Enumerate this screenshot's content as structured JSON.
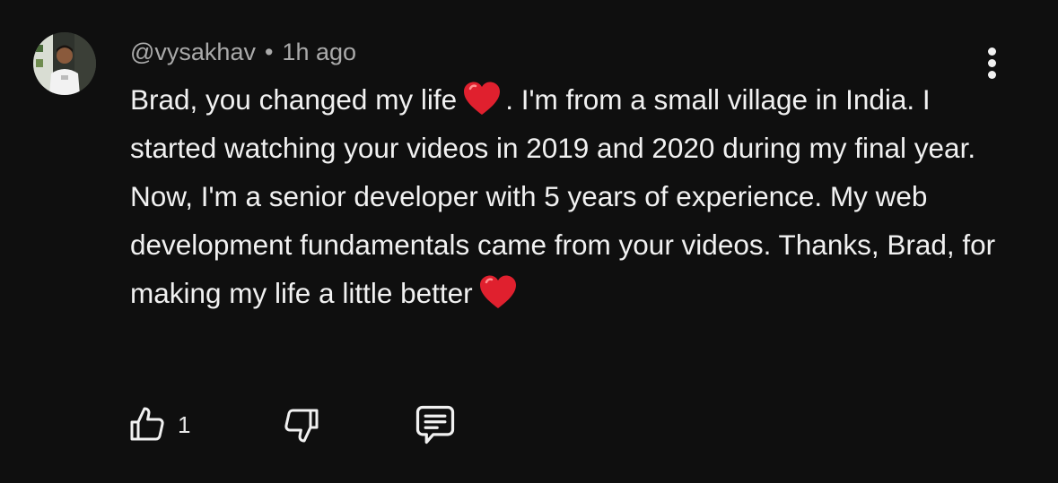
{
  "comment": {
    "author": "@vysakhav",
    "separator": "•",
    "time": "1h ago",
    "text_parts": [
      "Brad, you changed my life",
      ". I'm from a small village in India. I started watching your videos in 2019 and 2020 during my final year. Now, I'm a senior developer with 5 years of experience. My web development fundamentals came from your videos. Thanks, Brad, for making my life a little better"
    ],
    "like_count": "1"
  },
  "icons": {
    "avatar": "avatar",
    "heart": "red-heart-emoji",
    "more": "more-vertical-icon",
    "like": "thumbs-up-icon",
    "dislike": "thumbs-down-icon",
    "reply": "reply-comment-icon"
  },
  "colors": {
    "background": "#0f0f0f",
    "text": "#f1f1f1",
    "muted": "#aaaaaa",
    "heart": "#e0202e"
  }
}
